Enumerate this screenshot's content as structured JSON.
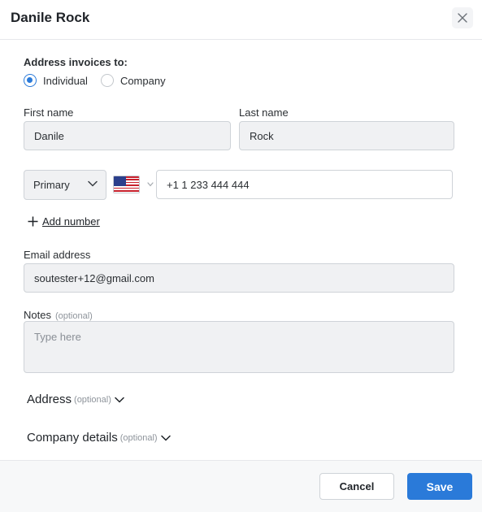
{
  "header": {
    "title": "Danile Rock",
    "close_label": "X"
  },
  "address_invoices": {
    "label": "Address invoices to:",
    "options": [
      {
        "label": "Individual",
        "selected": true
      },
      {
        "label": "Company",
        "selected": false
      }
    ]
  },
  "first_name": {
    "label": "First name",
    "value": "Danile"
  },
  "last_name": {
    "label": "Last name",
    "value": "Rock"
  },
  "phone": {
    "type_value": "Primary",
    "country_flag": "us-flag-icon",
    "number": "+1 1 233 444 444",
    "add_number_label": "Add number"
  },
  "email": {
    "label": "Email address",
    "value": "soutester+12@gmail.com"
  },
  "notes": {
    "label": "Notes",
    "optional": "(optional)",
    "placeholder": "Type here"
  },
  "address_section": {
    "label": "Address",
    "optional": "(optional)"
  },
  "company_section": {
    "label": "Company details",
    "optional": "(optional)"
  },
  "footer": {
    "cancel_label": "Cancel",
    "save_label": "Save"
  },
  "colors": {
    "accent": "#2a7ad9",
    "field_bg": "#f0f1f3",
    "border": "#cfd3d8"
  }
}
